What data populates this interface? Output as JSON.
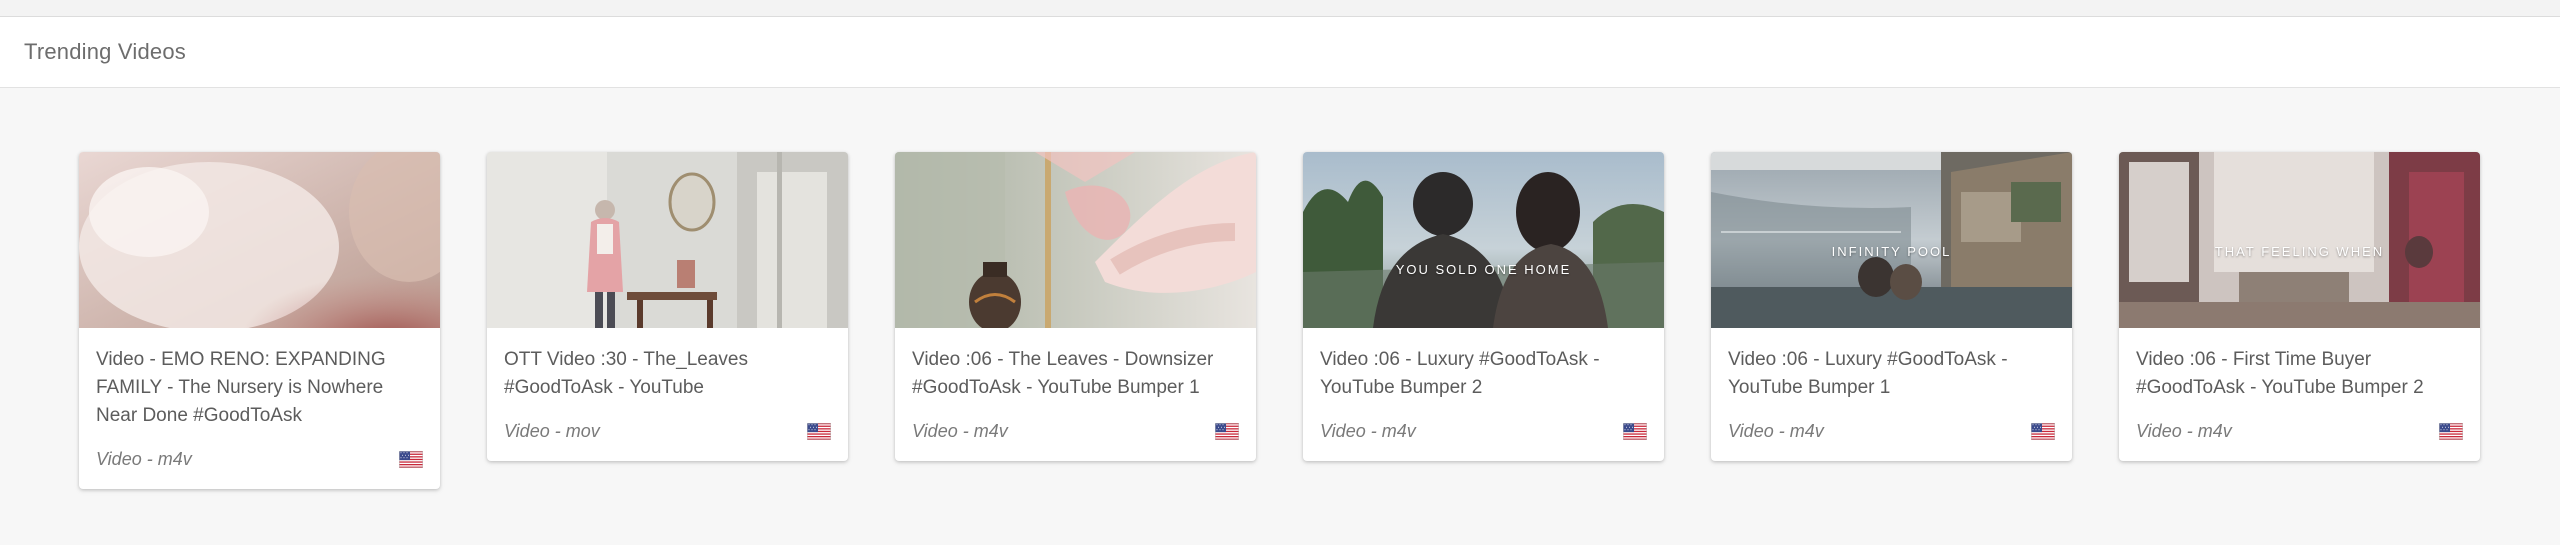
{
  "section": {
    "title": "Trending Videos"
  },
  "videos": [
    {
      "title": "Video - EMO RENO: EXPANDING FAMILY - The Nursery is Nowhere Near Done #GoodToAsk",
      "meta": "Video - m4v",
      "overlay": "",
      "flag": "us-flag-icon"
    },
    {
      "title": "OTT Video :30 - The_Leaves #GoodToAsk - YouTube",
      "meta": "Video - mov",
      "overlay": "",
      "flag": "us-flag-icon"
    },
    {
      "title": "Video :06 - The Leaves - Downsizer #GoodToAsk - YouTube Bumper 1",
      "meta": "Video - m4v",
      "overlay": "",
      "flag": "us-flag-icon"
    },
    {
      "title": "Video :06 - Luxury #GoodToAsk - YouTube Bumper 2",
      "meta": "Video - m4v",
      "overlay": "YOU SOLD ONE HOME",
      "flag": "us-flag-icon"
    },
    {
      "title": "Video :06 - Luxury #GoodToAsk - YouTube Bumper 1",
      "meta": "Video - m4v",
      "overlay": "INFINITY POOL",
      "flag": "us-flag-icon"
    },
    {
      "title": "Video :06 - First Time Buyer #GoodToAsk - YouTube Bumper 2",
      "meta": "Video - m4v",
      "overlay": "THAT FEELING WHEN",
      "flag": "us-flag-icon"
    }
  ]
}
